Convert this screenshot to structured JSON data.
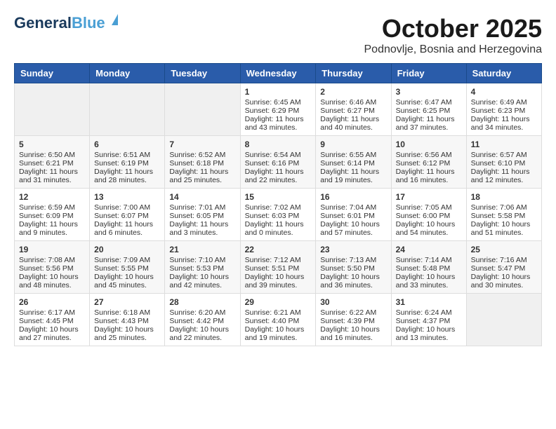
{
  "header": {
    "logo_line1": "General",
    "logo_line2": "Blue",
    "month": "October 2025",
    "location": "Podnovlje, Bosnia and Herzegovina"
  },
  "weekdays": [
    "Sunday",
    "Monday",
    "Tuesday",
    "Wednesday",
    "Thursday",
    "Friday",
    "Saturday"
  ],
  "weeks": [
    [
      {
        "day": "",
        "data": ""
      },
      {
        "day": "",
        "data": ""
      },
      {
        "day": "",
        "data": ""
      },
      {
        "day": "1",
        "data": "Sunrise: 6:45 AM\nSunset: 6:29 PM\nDaylight: 11 hours\nand 43 minutes."
      },
      {
        "day": "2",
        "data": "Sunrise: 6:46 AM\nSunset: 6:27 PM\nDaylight: 11 hours\nand 40 minutes."
      },
      {
        "day": "3",
        "data": "Sunrise: 6:47 AM\nSunset: 6:25 PM\nDaylight: 11 hours\nand 37 minutes."
      },
      {
        "day": "4",
        "data": "Sunrise: 6:49 AM\nSunset: 6:23 PM\nDaylight: 11 hours\nand 34 minutes."
      }
    ],
    [
      {
        "day": "5",
        "data": "Sunrise: 6:50 AM\nSunset: 6:21 PM\nDaylight: 11 hours\nand 31 minutes."
      },
      {
        "day": "6",
        "data": "Sunrise: 6:51 AM\nSunset: 6:19 PM\nDaylight: 11 hours\nand 28 minutes."
      },
      {
        "day": "7",
        "data": "Sunrise: 6:52 AM\nSunset: 6:18 PM\nDaylight: 11 hours\nand 25 minutes."
      },
      {
        "day": "8",
        "data": "Sunrise: 6:54 AM\nSunset: 6:16 PM\nDaylight: 11 hours\nand 22 minutes."
      },
      {
        "day": "9",
        "data": "Sunrise: 6:55 AM\nSunset: 6:14 PM\nDaylight: 11 hours\nand 19 minutes."
      },
      {
        "day": "10",
        "data": "Sunrise: 6:56 AM\nSunset: 6:12 PM\nDaylight: 11 hours\nand 16 minutes."
      },
      {
        "day": "11",
        "data": "Sunrise: 6:57 AM\nSunset: 6:10 PM\nDaylight: 11 hours\nand 12 minutes."
      }
    ],
    [
      {
        "day": "12",
        "data": "Sunrise: 6:59 AM\nSunset: 6:09 PM\nDaylight: 11 hours\nand 9 minutes."
      },
      {
        "day": "13",
        "data": "Sunrise: 7:00 AM\nSunset: 6:07 PM\nDaylight: 11 hours\nand 6 minutes."
      },
      {
        "day": "14",
        "data": "Sunrise: 7:01 AM\nSunset: 6:05 PM\nDaylight: 11 hours\nand 3 minutes."
      },
      {
        "day": "15",
        "data": "Sunrise: 7:02 AM\nSunset: 6:03 PM\nDaylight: 11 hours\nand 0 minutes."
      },
      {
        "day": "16",
        "data": "Sunrise: 7:04 AM\nSunset: 6:01 PM\nDaylight: 10 hours\nand 57 minutes."
      },
      {
        "day": "17",
        "data": "Sunrise: 7:05 AM\nSunset: 6:00 PM\nDaylight: 10 hours\nand 54 minutes."
      },
      {
        "day": "18",
        "data": "Sunrise: 7:06 AM\nSunset: 5:58 PM\nDaylight: 10 hours\nand 51 minutes."
      }
    ],
    [
      {
        "day": "19",
        "data": "Sunrise: 7:08 AM\nSunset: 5:56 PM\nDaylight: 10 hours\nand 48 minutes."
      },
      {
        "day": "20",
        "data": "Sunrise: 7:09 AM\nSunset: 5:55 PM\nDaylight: 10 hours\nand 45 minutes."
      },
      {
        "day": "21",
        "data": "Sunrise: 7:10 AM\nSunset: 5:53 PM\nDaylight: 10 hours\nand 42 minutes."
      },
      {
        "day": "22",
        "data": "Sunrise: 7:12 AM\nSunset: 5:51 PM\nDaylight: 10 hours\nand 39 minutes."
      },
      {
        "day": "23",
        "data": "Sunrise: 7:13 AM\nSunset: 5:50 PM\nDaylight: 10 hours\nand 36 minutes."
      },
      {
        "day": "24",
        "data": "Sunrise: 7:14 AM\nSunset: 5:48 PM\nDaylight: 10 hours\nand 33 minutes."
      },
      {
        "day": "25",
        "data": "Sunrise: 7:16 AM\nSunset: 5:47 PM\nDaylight: 10 hours\nand 30 minutes."
      }
    ],
    [
      {
        "day": "26",
        "data": "Sunrise: 6:17 AM\nSunset: 4:45 PM\nDaylight: 10 hours\nand 27 minutes."
      },
      {
        "day": "27",
        "data": "Sunrise: 6:18 AM\nSunset: 4:43 PM\nDaylight: 10 hours\nand 25 minutes."
      },
      {
        "day": "28",
        "data": "Sunrise: 6:20 AM\nSunset: 4:42 PM\nDaylight: 10 hours\nand 22 minutes."
      },
      {
        "day": "29",
        "data": "Sunrise: 6:21 AM\nSunset: 4:40 PM\nDaylight: 10 hours\nand 19 minutes."
      },
      {
        "day": "30",
        "data": "Sunrise: 6:22 AM\nSunset: 4:39 PM\nDaylight: 10 hours\nand 16 minutes."
      },
      {
        "day": "31",
        "data": "Sunrise: 6:24 AM\nSunset: 4:37 PM\nDaylight: 10 hours\nand 13 minutes."
      },
      {
        "day": "",
        "data": ""
      }
    ]
  ]
}
